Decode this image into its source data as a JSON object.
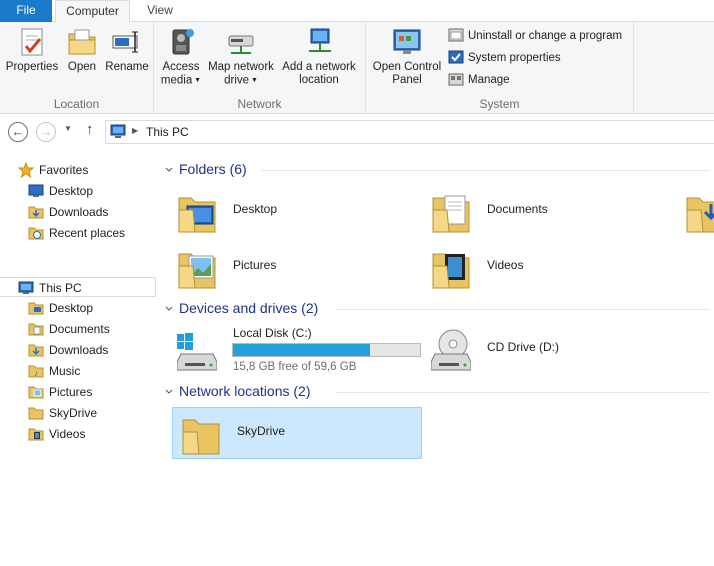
{
  "tabs": {
    "file": "File",
    "computer": "Computer",
    "view": "View"
  },
  "ribbon": {
    "location": {
      "label": "Location",
      "properties": "Properties",
      "open": "Open",
      "rename": "Rename"
    },
    "network": {
      "label": "Network",
      "access_media_1": "Access",
      "access_media_2": "media",
      "map_drive_1": "Map network",
      "map_drive_2": "drive",
      "add_location_1": "Add a network",
      "add_location_2": "location"
    },
    "system": {
      "label": "System",
      "control_panel_1": "Open Control",
      "control_panel_2": "Panel",
      "uninstall": "Uninstall or change a program",
      "properties": "System properties",
      "manage": "Manage"
    }
  },
  "address": {
    "path": "This PC"
  },
  "sidebar": {
    "favorites": "Favorites",
    "fav_items": [
      "Desktop",
      "Downloads",
      "Recent places"
    ],
    "this_pc": "This PC",
    "pc_items": [
      "Desktop",
      "Documents",
      "Downloads",
      "Music",
      "Pictures",
      "SkyDrive",
      "Videos"
    ]
  },
  "content": {
    "folders_title": "Folders (6)",
    "folders": [
      "Desktop",
      "Documents",
      "Pictures",
      "Videos"
    ],
    "devices_title": "Devices and drives (2)",
    "local_disk": {
      "name": "Local Disk (C:)",
      "free_text": "15,8 GB free of 59,6 GB",
      "used_fraction": 0.735
    },
    "cd_drive": "CD Drive (D:)",
    "network_title": "Network locations (2)",
    "network_items": [
      "SkyDrive"
    ]
  },
  "colors": {
    "accent": "#1979ca",
    "section_title": "#1e3287",
    "selection": "#cce8ff",
    "drive_bar": "#26a0da"
  }
}
